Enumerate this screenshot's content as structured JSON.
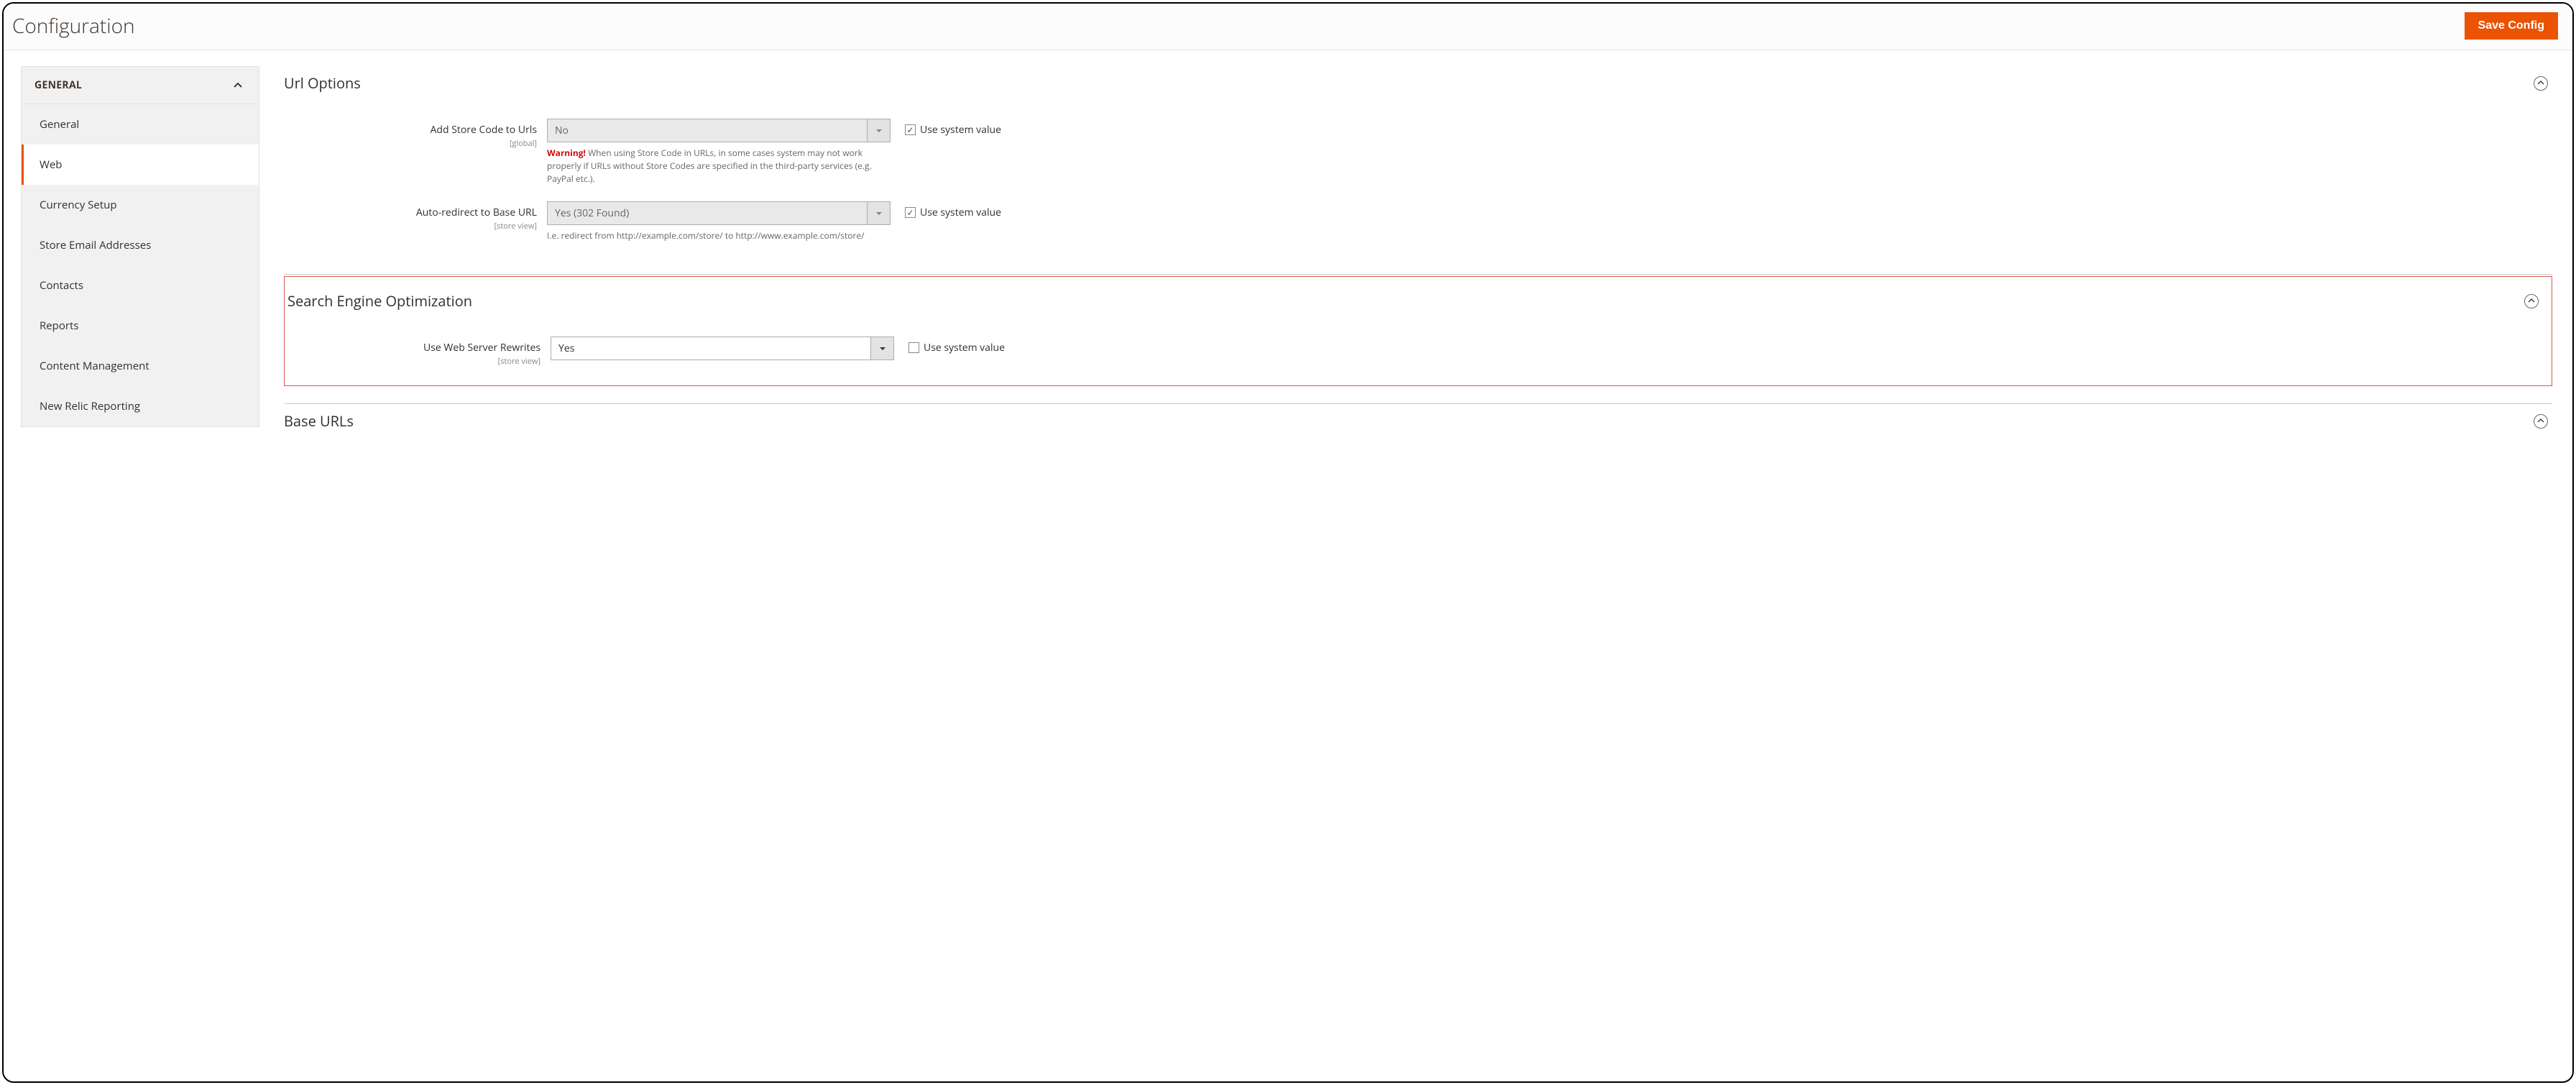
{
  "header": {
    "title": "Configuration",
    "save": "Save Config"
  },
  "sidebar": {
    "group": "GENERAL",
    "items": [
      {
        "label": "General"
      },
      {
        "label": "Web"
      },
      {
        "label": "Currency Setup"
      },
      {
        "label": "Store Email Addresses"
      },
      {
        "label": "Contacts"
      },
      {
        "label": "Reports"
      },
      {
        "label": "Content Management"
      },
      {
        "label": "New Relic Reporting"
      }
    ]
  },
  "sections": {
    "url": {
      "title": "Url Options",
      "store_code": {
        "label": "Add Store Code to Urls",
        "scope": "[global]",
        "value": "No",
        "warn_label": "Warning!",
        "warn_text": " When using Store Code in URLs, in some cases system may not work properly if URLs without Store Codes are specified in the third-party services (e.g. PayPal etc.).",
        "sys": "Use system value"
      },
      "auto_redirect": {
        "label": "Auto-redirect to Base URL",
        "scope": "[store view]",
        "value": "Yes (302 Found)",
        "hint": "I.e. redirect from http://example.com/store/ to http://www.example.com/store/",
        "sys": "Use system value"
      }
    },
    "seo": {
      "title": "Search Engine Optimization",
      "rewrites": {
        "label": "Use Web Server Rewrites",
        "scope": "[store view]",
        "value": "Yes",
        "sys": "Use system value"
      }
    },
    "base": {
      "title": "Base URLs"
    }
  }
}
